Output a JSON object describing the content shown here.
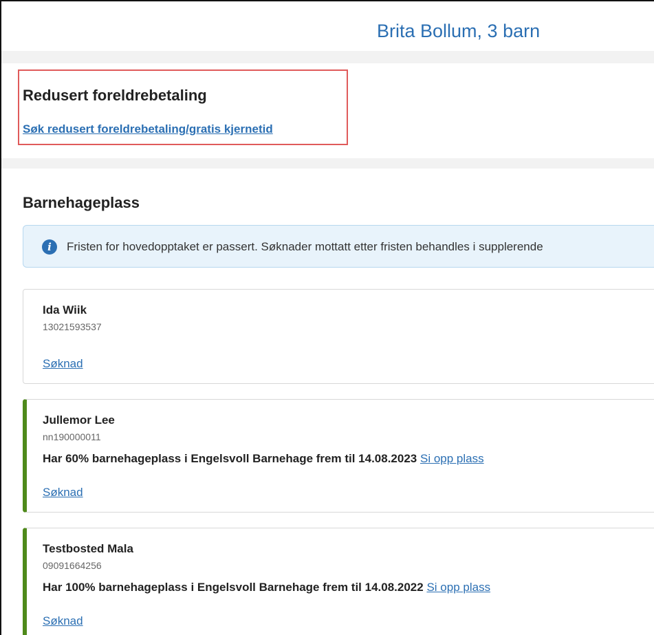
{
  "header": {
    "title": "Brita Bollum, 3 barn"
  },
  "reduced_payment": {
    "title": "Redusert foreldrebetaling",
    "link": "Søk redusert foreldrebetaling/gratis kjernetid"
  },
  "kindergarten": {
    "title": "Barnehageplass",
    "info_text": "Fristen for hovedopptaket er passert. Søknader mottatt etter fristen behandles i supplerende",
    "children": [
      {
        "name": "Ida Wiik",
        "id": "13021593537",
        "placement": "",
        "cancel_link": "",
        "application_link": "Søknad"
      },
      {
        "name": "Jullemor Lee",
        "id": "nn190000011",
        "placement": "Har 60% barnehageplass i Engelsvoll Barnehage frem til 14.08.2023",
        "cancel_link": "Si opp plass",
        "application_link": "Søknad"
      },
      {
        "name": "Testbosted Mala",
        "id": "09091664256",
        "placement": "Har 100% barnehageplass i Engelsvoll Barnehage frem til 14.08.2022",
        "cancel_link": "Si opp plass",
        "application_link": "Søknad"
      }
    ]
  },
  "colors": {
    "link": "#2b6fb3",
    "highlight_border": "#e05a5a",
    "active_accent": "#4f8a1b",
    "info_background": "#e8f3fb"
  },
  "icons": {
    "info": "info-icon"
  }
}
